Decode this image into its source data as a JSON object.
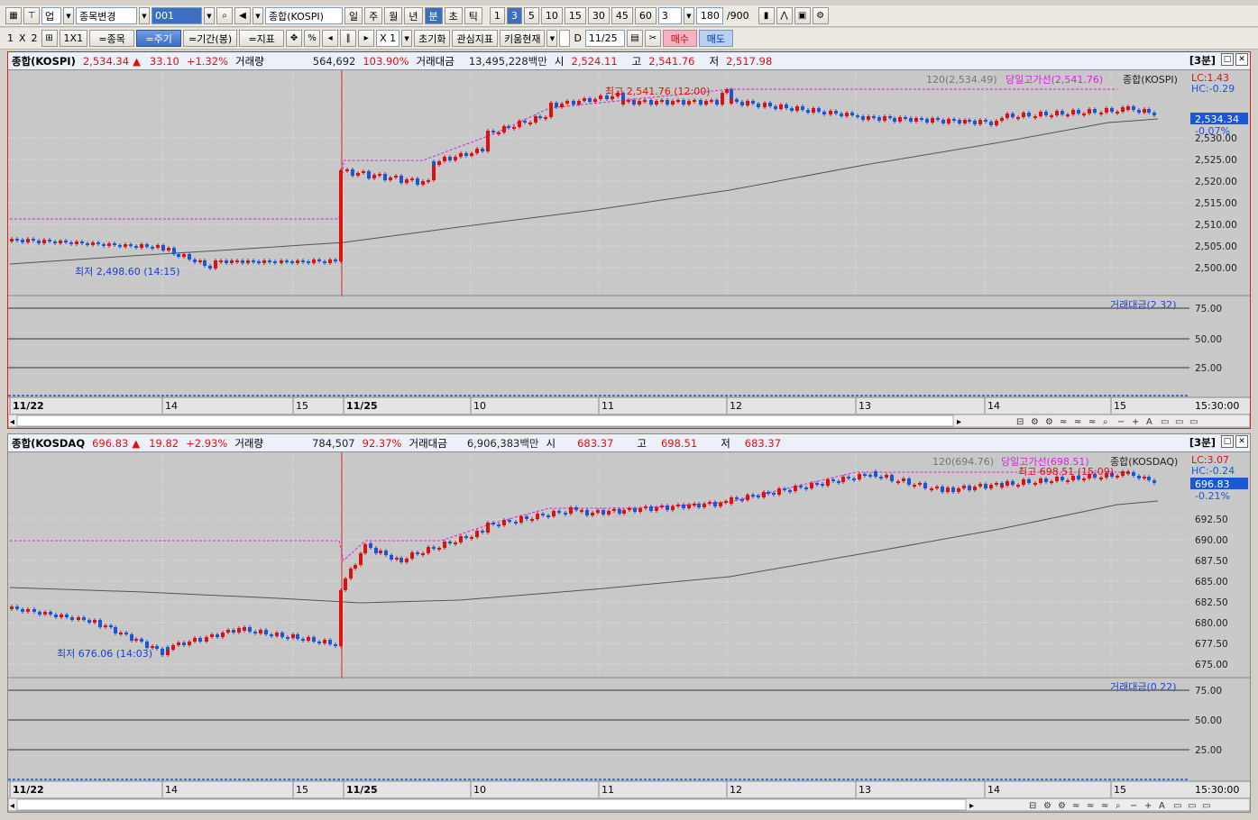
{
  "toolbar1": {
    "market": "업",
    "stock_change": "종목변경",
    "code": "001",
    "stock_name": "종합(KOSPI)",
    "periods": [
      "일",
      "주",
      "월",
      "년",
      "분",
      "초",
      "틱"
    ],
    "active_period": "분",
    "intervals": [
      "1",
      "3",
      "5",
      "10",
      "15",
      "30",
      "45",
      "60"
    ],
    "active_interval": "3",
    "interval_value": "3",
    "count": "180",
    "count_total": "/900"
  },
  "toolbar2": {
    "layout_1": "1",
    "layout_x": "X",
    "layout_2": "2",
    "layout_1x1": "1X1",
    "items": "=종목",
    "period": "=주기",
    "range": "=기간(봉)",
    "indicator": "=지표",
    "zoom": "X 1",
    "reset": "초기화",
    "watch": "관심지표",
    "kiwoom": "키움현재",
    "d_label": "D",
    "date": "11/25",
    "buy": "매수",
    "sell": "매도"
  },
  "panel1": {
    "name": "종합(KOSPI)",
    "price": "2,534.34",
    "arrow": "▲",
    "change": "33.10",
    "change_pct": "+1.32%",
    "vol_label": "거래량",
    "vol": "564,692",
    "vol_pct": "103.90%",
    "amt_label": "거래대금",
    "amt": "13,495,228백만",
    "open_label": "시",
    "open": "2,524.11",
    "high_label": "고",
    "high": "2,541.76",
    "low_label": "저",
    "low": "2,517.98",
    "timeframe": "[3분]",
    "ma_label": "120(2,534.49)",
    "day_high_line": "당일고가선(2,541.76)",
    "chart_name": "종합(KOSPI)",
    "lc": "LC:1.43",
    "hc": "HC:-0.29",
    "cur_price_tag": "2,534.34",
    "cur_pct_tag": "-0.07%",
    "max_annot": "최고 2,541.76 (12:00)",
    "min_annot": "최저 2,498.60 (14:15)",
    "y_ticks": [
      "2,530.00",
      "2,525.00",
      "2,520.00",
      "2,515.00",
      "2,510.00",
      "2,505.00",
      "2,500.00"
    ],
    "sub_label": "거래대금(2.32)",
    "sub_ticks": [
      "75.00",
      "50.00",
      "25.00"
    ],
    "x_labels": [
      "11/22",
      "14",
      "15",
      "11/25",
      "10",
      "11",
      "12",
      "13",
      "14",
      "15"
    ],
    "time_label": "15:30:00"
  },
  "panel2": {
    "name": "종합(KOSDAQ",
    "price": "696.83",
    "arrow": "▲",
    "change": "19.82",
    "change_pct": "+2.93%",
    "vol_label": "거래량",
    "vol": "784,507",
    "vol_pct": "92.37%",
    "amt_label": "거래대금",
    "amt": "6,906,383백만",
    "open_label": "시",
    "open": "683.37",
    "high_label": "고",
    "high": "698.51",
    "low_label": "저",
    "low": "683.37",
    "timeframe": "[3분]",
    "ma_label": "120(694.76)",
    "day_high_line": "당일고가선(698.51)",
    "chart_name": "종합(KOSDAQ)",
    "lc": "LC:3.07",
    "hc": "HC:-0.24",
    "cur_price_tag": "696.83",
    "cur_pct_tag": "-0.21%",
    "max_annot": "최고 698.51 (15:09)",
    "min_annot": "최저 676.06 (14:03)",
    "y_ticks": [
      "692.50",
      "690.00",
      "687.50",
      "685.00",
      "682.50",
      "680.00",
      "677.50",
      "675.00"
    ],
    "sub_label": "거래대금(0.22)",
    "sub_ticks": [
      "75.00",
      "50.00",
      "25.00"
    ],
    "x_labels": [
      "11/22",
      "14",
      "15",
      "11/25",
      "10",
      "11",
      "12",
      "13",
      "14",
      "15"
    ],
    "time_label": "15:30:00"
  },
  "colors": {
    "up": "#e01010",
    "down": "#1a56d6",
    "ma": "#555555",
    "highline": "#e020e0"
  }
}
